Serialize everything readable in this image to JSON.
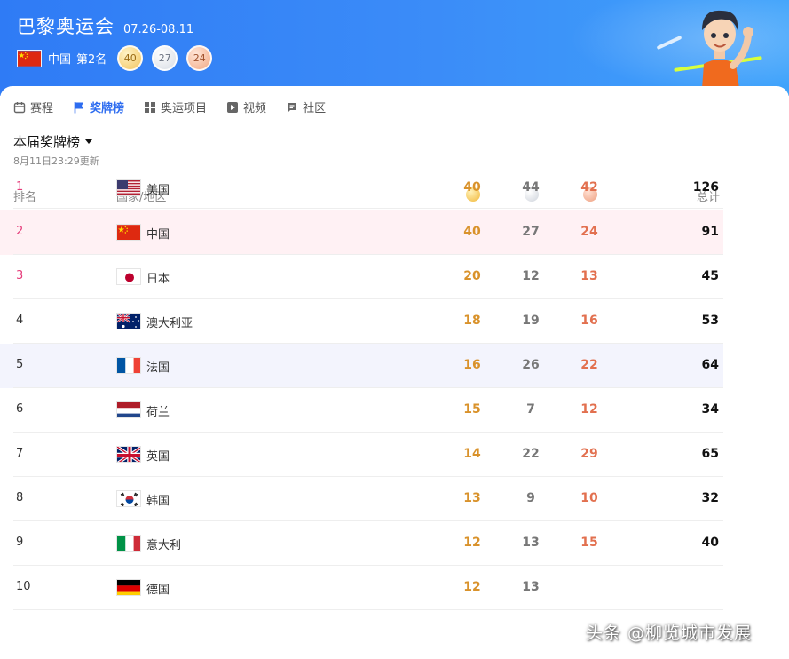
{
  "header": {
    "title": "巴黎奥运会",
    "dates": "07.26-08.11",
    "country": "中国",
    "rank": "第2名",
    "gold": "40",
    "silver": "27",
    "bronze": "24"
  },
  "tabs": [
    {
      "label": "赛程",
      "icon": "calendar-icon",
      "active": false
    },
    {
      "label": "奖牌榜",
      "icon": "flag-icon",
      "active": true
    },
    {
      "label": "奥运项目",
      "icon": "grid-icon",
      "active": false
    },
    {
      "label": "视频",
      "icon": "play-icon",
      "active": false
    },
    {
      "label": "社区",
      "icon": "chat-icon",
      "active": false
    }
  ],
  "section": {
    "title": "本届奖牌榜",
    "updated": "8月11日23:29更新"
  },
  "table": {
    "columns": {
      "rank": "排名",
      "country": "国家/地区",
      "total": "总计"
    },
    "rows": [
      {
        "rank": "1",
        "name": "美国",
        "gold": "40",
        "silver": "44",
        "bronze": "42",
        "total": "126"
      },
      {
        "rank": "2",
        "name": "中国",
        "gold": "40",
        "silver": "27",
        "bronze": "24",
        "total": "91"
      },
      {
        "rank": "3",
        "name": "日本",
        "gold": "20",
        "silver": "12",
        "bronze": "13",
        "total": "45"
      },
      {
        "rank": "4",
        "name": "澳大利亚",
        "gold": "18",
        "silver": "19",
        "bronze": "16",
        "total": "53"
      },
      {
        "rank": "5",
        "name": "法国",
        "gold": "16",
        "silver": "26",
        "bronze": "22",
        "total": "64"
      },
      {
        "rank": "6",
        "name": "荷兰",
        "gold": "15",
        "silver": "7",
        "bronze": "12",
        "total": "34"
      },
      {
        "rank": "7",
        "name": "英国",
        "gold": "14",
        "silver": "22",
        "bronze": "29",
        "total": "65"
      },
      {
        "rank": "8",
        "name": "韩国",
        "gold": "13",
        "silver": "9",
        "bronze": "10",
        "total": "32"
      },
      {
        "rank": "9",
        "name": "意大利",
        "gold": "12",
        "silver": "13",
        "bronze": "15",
        "total": "40"
      },
      {
        "rank": "10",
        "name": "德国",
        "gold": "12",
        "silver": "13",
        "bronze": "",
        "total": ""
      }
    ]
  },
  "colors": {
    "header_blue": "#3b8cf8",
    "accent": "#2d6cf0",
    "gold": "#d9922b",
    "bronze": "#e2704f",
    "rank_top": "#e53c7a"
  },
  "watermark": "头条 @柳览城市发展"
}
